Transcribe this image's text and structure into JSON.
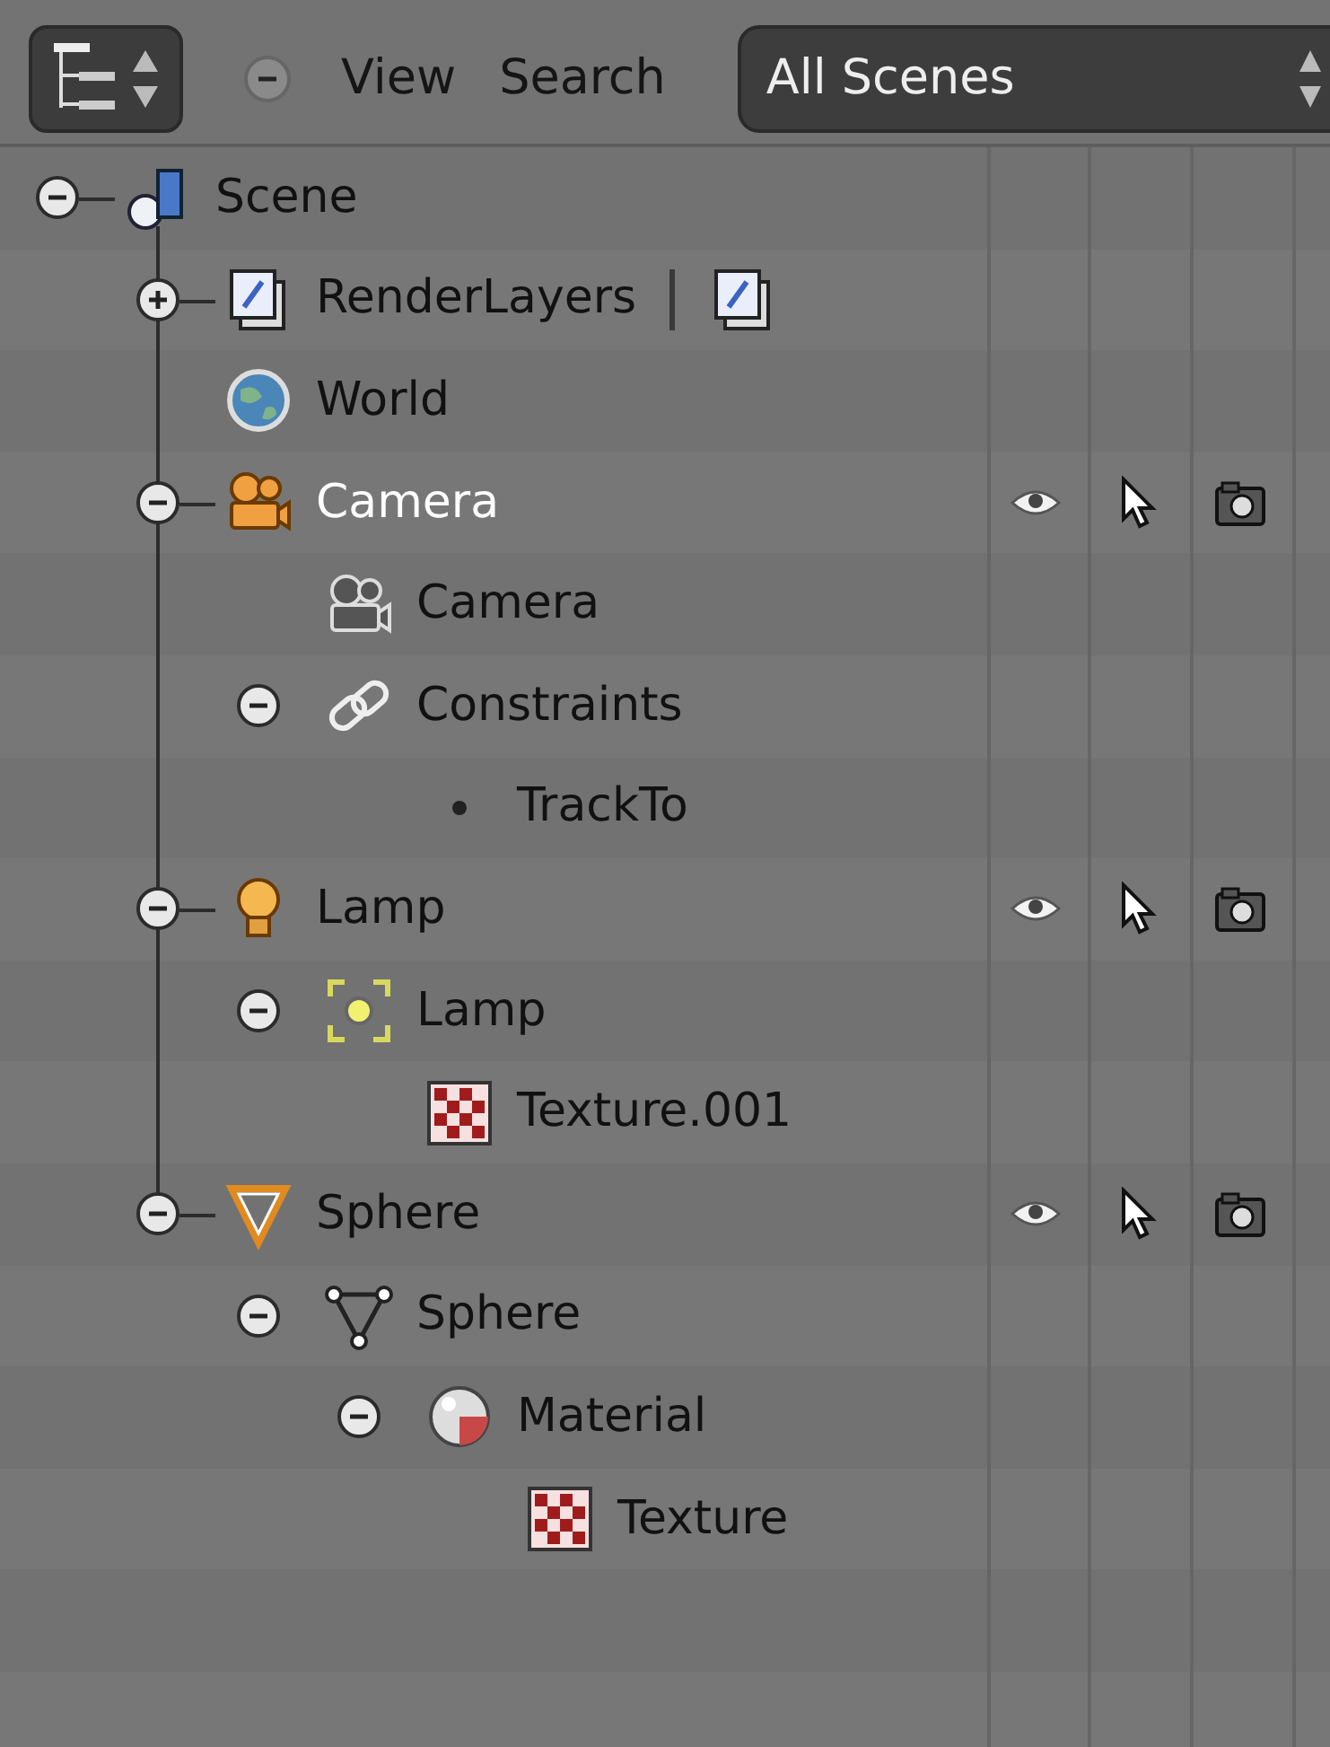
{
  "header": {
    "view_menu": "View",
    "search_menu": "Search",
    "display_mode": "All Scenes"
  },
  "tree": [
    {
      "label": "Scene",
      "kind": "scene",
      "expanded": true,
      "active": false,
      "children": [
        {
          "label": "RenderLayers",
          "kind": "renderlayers",
          "expanded": false,
          "active": false,
          "layer_button": true
        },
        {
          "label": "World",
          "kind": "world",
          "active": false
        },
        {
          "label": "Camera",
          "kind": "camera_object",
          "expanded": true,
          "active": true,
          "visible": true,
          "selectable": true,
          "renderable": true,
          "children": [
            {
              "label": "Camera",
              "kind": "camera_data",
              "active": false
            },
            {
              "label": "Constraints",
              "kind": "constraints",
              "expanded": true,
              "active": false,
              "children": [
                {
                  "label": "TrackTo",
                  "kind": "constraint_item",
                  "active": false
                }
              ]
            }
          ]
        },
        {
          "label": "Lamp",
          "kind": "lamp_object",
          "expanded": true,
          "active": false,
          "visible": true,
          "selectable": true,
          "renderable": true,
          "children": [
            {
              "label": "Lamp",
              "kind": "lamp_data",
              "expanded": true,
              "active": false,
              "children": [
                {
                  "label": "Texture.001",
                  "kind": "texture",
                  "active": false
                }
              ]
            }
          ]
        },
        {
          "label": "Sphere",
          "kind": "mesh_object",
          "expanded": true,
          "active": false,
          "visible": true,
          "selectable": true,
          "renderable": true,
          "children": [
            {
              "label": "Sphere",
              "kind": "mesh_data",
              "expanded": true,
              "active": false,
              "children": [
                {
                  "label": "Material",
                  "kind": "material",
                  "expanded": true,
                  "active": false,
                  "children": [
                    {
                      "label": "Texture",
                      "kind": "texture",
                      "active": false
                    }
                  ]
                }
              ]
            }
          ]
        }
      ]
    }
  ]
}
